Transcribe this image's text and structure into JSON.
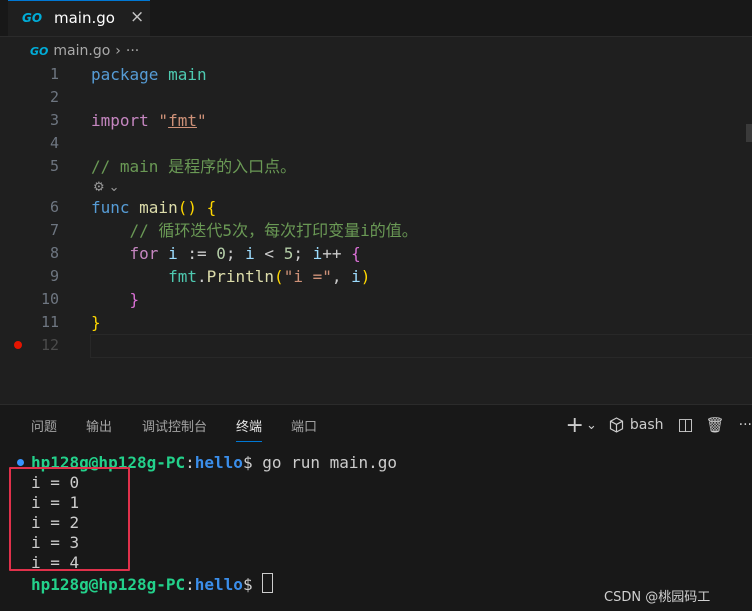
{
  "tab": {
    "icon_text": "GO",
    "title": "main.go",
    "close": "×"
  },
  "breadcrumb": {
    "icon_text": "GO",
    "file": "main.go",
    "sep": "›",
    "more": "···"
  },
  "editor": {
    "line_numbers": [
      "1",
      "2",
      "3",
      "4",
      "5",
      "6",
      "7",
      "8",
      "9",
      "10",
      "11",
      "12"
    ],
    "codelens": "⚙",
    "codelens_chevron": "⌄",
    "lines": {
      "l1_kw": "package",
      "l1_name": " main",
      "l3_kw": "import",
      "l3_q1": " \"",
      "l3_pkg": "fmt",
      "l3_q2": "\"",
      "l5_comment": "// main 是程序的入口点。",
      "l6_kw": "func",
      "l6_fn": " main",
      "l6_paren": "()",
      "l6_brace": " {",
      "l7_comment": "    // 循环迭代5次，每次打印变量i的值。",
      "l8_indent": "    ",
      "l8_for": "for",
      "l8_i1": " i",
      "l8_assign": " := ",
      "l8_zero": "0",
      "l8_semi1": "; ",
      "l8_i2": "i",
      "l8_lt": " < ",
      "l8_five": "5",
      "l8_semi2": "; ",
      "l8_i3": "i",
      "l8_inc": "++",
      "l8_brace": " {",
      "l9_indent": "        ",
      "l9_pkg": "fmt",
      "l9_dot": ".",
      "l9_fn": "Println",
      "l9_open": "(",
      "l9_str": "\"i =\"",
      "l9_comma": ", ",
      "l9_i": "i",
      "l9_close": ")",
      "l10_indent": "    ",
      "l10_brace": "}",
      "l11_brace": "}"
    }
  },
  "panel": {
    "tabs": [
      "问题",
      "输出",
      "调试控制台",
      "终端",
      "端口"
    ],
    "active_tab": "终端",
    "actions": {
      "add": "+",
      "add_chevron": "⌄",
      "shell": "bash",
      "split": "◫",
      "trash": "🗑",
      "more": "···"
    }
  },
  "terminal": {
    "prompt_user": "hp128g@hp128g-PC",
    "prompt_colon": ":",
    "prompt_path": "hello",
    "prompt_dollar": "$ ",
    "command": "go run main.go",
    "outputs": [
      "i = 0",
      "i = 1",
      "i = 2",
      "i = 3",
      "i = 4"
    ]
  },
  "watermark": "CSDN @桃园码工",
  "colors": {
    "accent": "#0078d4",
    "breakpoint": "#e51400",
    "highlight_box": "#e0314b",
    "prompt_user": "#23d18b",
    "prompt_path": "#3b8eea"
  }
}
